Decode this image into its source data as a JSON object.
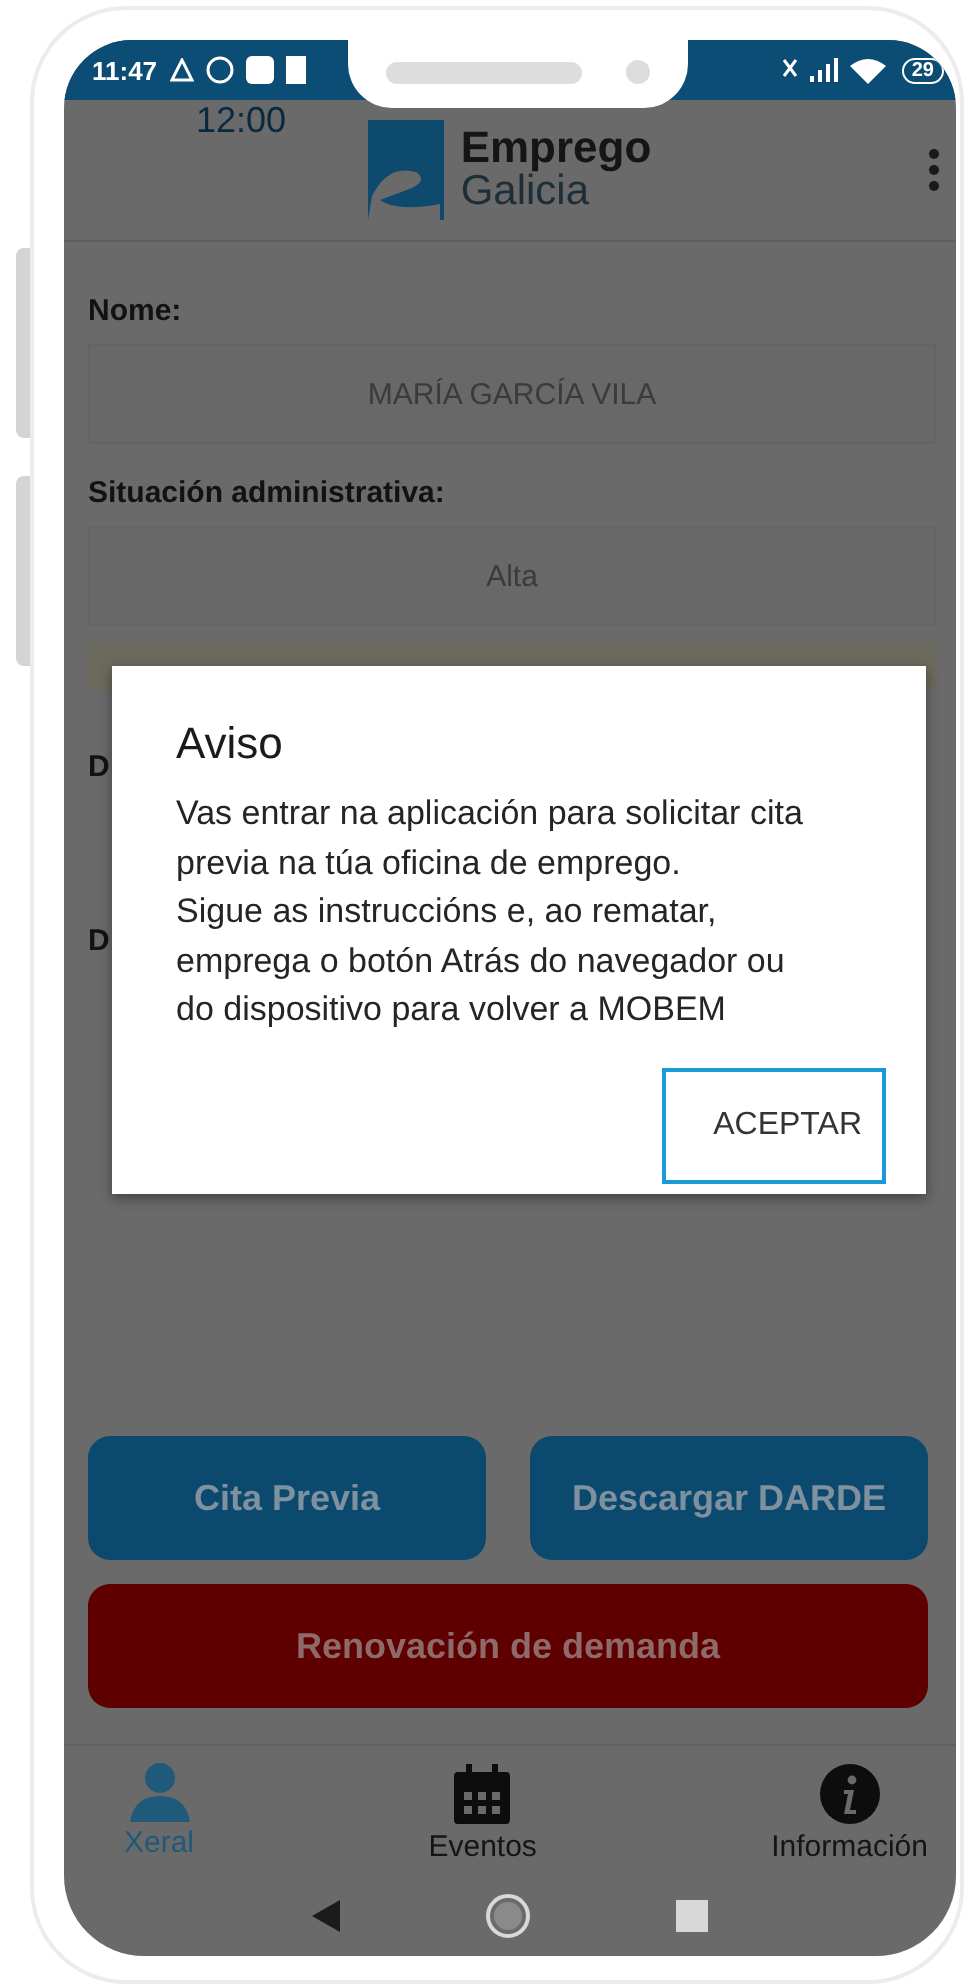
{
  "status_bar": {
    "time": "12:00",
    "clock": "11:47",
    "battery": "29"
  },
  "header": {
    "logo_top": "Emprego",
    "logo_bottom": "Galicia"
  },
  "fields": [
    {
      "label": "Nome:",
      "value": "MARÍA GARCÍA VILA"
    },
    {
      "label": "Situación administrativa:",
      "value": "Alta"
    }
  ],
  "hidden_labels": [
    "D",
    "D"
  ],
  "dialog": {
    "title": "Aviso",
    "body": [
      "Vas entrar na aplicación para solicitar cita previa na túa oficina de emprego.",
      "Sigue as instruccións e, ao rematar, emprega o botón Atrás do navegador ou do dispositivo para volver a MOBEM"
    ],
    "button": "ACEPTAR"
  },
  "actions": [
    {
      "label": "Cita Previa",
      "kind": "primary"
    },
    {
      "label": "Descargar DARDE",
      "kind": "primary"
    },
    {
      "label": "Renovación de demanda",
      "kind": "danger"
    }
  ],
  "nav": [
    {
      "label": "Xeral",
      "kind": "person",
      "selected": true
    },
    {
      "label": "Eventos",
      "kind": "calendar",
      "selected": false
    },
    {
      "label": "Información",
      "kind": "info",
      "selected": false
    }
  ]
}
